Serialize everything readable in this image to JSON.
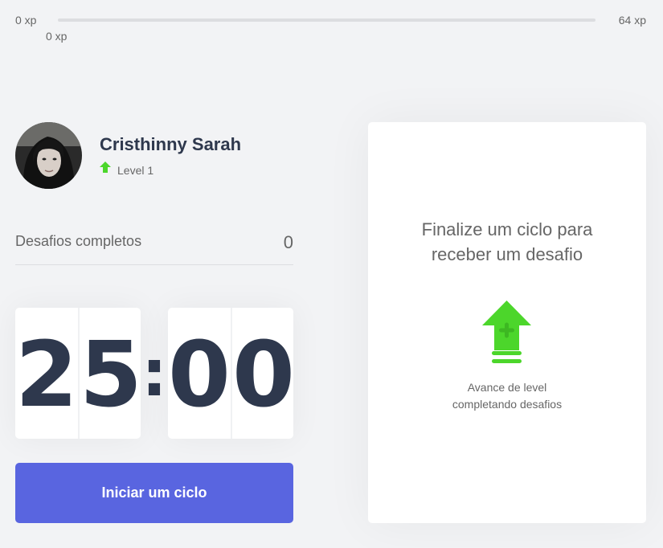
{
  "experience": {
    "min_label": "0 xp",
    "max_label": "64 xp",
    "current_label": "0 xp",
    "progress_fraction": 0
  },
  "profile": {
    "name": "Cristhinny Sarah",
    "level_label": "Level 1",
    "level_icon": "level-up-arrow-icon"
  },
  "challenges": {
    "label": "Desafios completos",
    "count": "0"
  },
  "countdown": {
    "minute_left": "2",
    "minute_right": "5",
    "separator": ":",
    "second_left": "0",
    "second_right": "0"
  },
  "start_button": {
    "label": "Iniciar um ciclo"
  },
  "challenge_box": {
    "title": "Finalize um ciclo para receber um desafio",
    "icon": "level-up-icon",
    "hint": "Avance de level completando desafios"
  },
  "colors": {
    "background": "#f2f3f5",
    "title": "#2e384d",
    "text": "#666666",
    "green": "#4cd62b",
    "blue": "#5965e0",
    "white": "#ffffff"
  }
}
